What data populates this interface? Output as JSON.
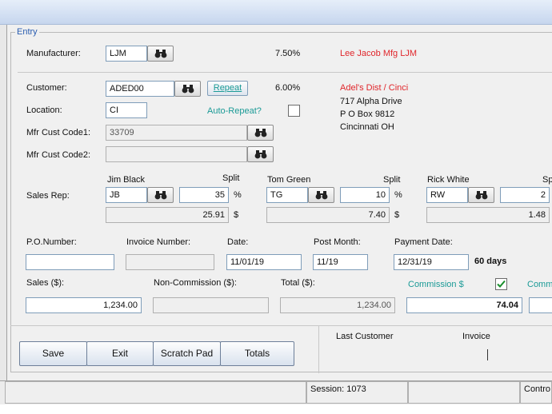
{
  "group_label": "Entry",
  "manufacturer": {
    "label": "Manufacturer:",
    "code": "LJM",
    "rate": "7.50%",
    "name": "Lee Jacob Mfg  LJM"
  },
  "customer": {
    "label": "Customer:",
    "code": "ADED00",
    "repeat_label": "Repeat",
    "rate": "6.00%",
    "name": "Adel's Dist / Cinci",
    "address": [
      "717 Alpha Drive",
      "P O Box 9812",
      "Cincinnati OH"
    ]
  },
  "location": {
    "label": "Location:",
    "value": "CI",
    "auto_repeat_label": "Auto-Repeat?"
  },
  "mfr_cust_code1": {
    "label": "Mfr Cust Code1:",
    "value": "33709"
  },
  "mfr_cust_code2": {
    "label": "Mfr Cust Code2:",
    "value": ""
  },
  "sales_rep": {
    "label": "Sales Rep:",
    "split_label": "Split",
    "percent_sign": "%",
    "dollar_sign": "$",
    "reps": [
      {
        "name": "Jim Black",
        "code": "JB",
        "split": "35",
        "amount": "25.91"
      },
      {
        "name": "Tom Green",
        "code": "TG",
        "split": "10",
        "amount": "7.40"
      },
      {
        "name": "Rick White",
        "code": "RW",
        "split": "2",
        "amount": "1.48",
        "split_label": "Sp"
      }
    ]
  },
  "po_number": {
    "label": "P.O.Number:",
    "value": ""
  },
  "invoice_number": {
    "label": "Invoice Number:",
    "value": ""
  },
  "date": {
    "label": "Date:",
    "value": "11/01/19"
  },
  "post_month": {
    "label": "Post Month:",
    "value": "11/19"
  },
  "payment_date": {
    "label": "Payment Date:",
    "value": "12/31/19",
    "days": "60  days"
  },
  "sales": {
    "label": "Sales ($):",
    "value": "1,234.00"
  },
  "non_commission": {
    "label": "Non-Commission ($):",
    "value": ""
  },
  "total": {
    "label": "Total ($):",
    "value": "1,234.00"
  },
  "commission": {
    "label": "Commission $",
    "value": "74.04",
    "checked": true,
    "cut_label": "Comm"
  },
  "buttons": {
    "save": "Save",
    "exit": "Exit",
    "scratch_pad": "Scratch Pad",
    "totals": "Totals"
  },
  "last_panel": {
    "last_customer": "Last Customer",
    "invoice": "Invoice"
  },
  "status": {
    "session": "Session: 1073",
    "control": "Contro"
  }
}
